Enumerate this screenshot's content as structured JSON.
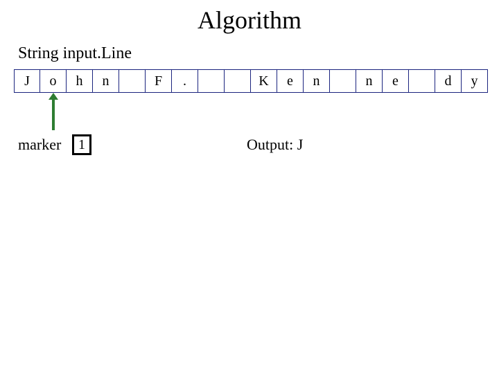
{
  "title": "Algorithm",
  "subtitle": "String input.Line",
  "cells": [
    "J",
    "o",
    "h",
    "n",
    "",
    "F",
    ".",
    "",
    "",
    "K",
    "e",
    "n",
    "",
    "n",
    "e",
    "",
    "d",
    "y"
  ],
  "arrow_cell_index": 1,
  "marker": {
    "label": "marker",
    "value": "1"
  },
  "output": {
    "label": "Output: J"
  }
}
